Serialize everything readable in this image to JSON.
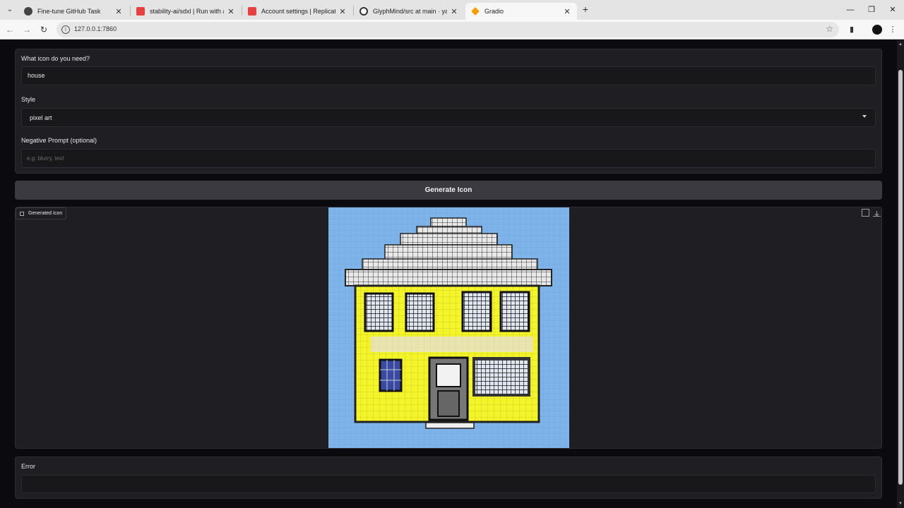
{
  "browser": {
    "tabs": [
      {
        "title": "Fine-tune GitHub Task",
        "icon": "openai-icon",
        "active": false
      },
      {
        "title": "stability-ai/sdxl | Run with an API",
        "icon": "replicate-icon",
        "active": false
      },
      {
        "title": "Account settings | Replicate",
        "icon": "replicate-icon",
        "active": false
      },
      {
        "title": "GlyphMind/src at main · yadukr",
        "icon": "github-icon",
        "active": false
      },
      {
        "title": "Gradio",
        "icon": "gradio-icon",
        "active": true
      }
    ],
    "url": "127.0.0.1:7860",
    "colors": {
      "replicate": "#e84040",
      "gradio": "#f59e0b"
    }
  },
  "form": {
    "prompt_label": "What icon do you need?",
    "prompt_value": "house",
    "style_label": "Style",
    "style_value": "pixel art",
    "negative_label": "Negative Prompt (optional)",
    "negative_placeholder": "e.g. blurry, text",
    "negative_value": ""
  },
  "generate_button": "Generate Icon",
  "output": {
    "label": "Generated Icon",
    "image_subject": "pixel-art-house-icon"
  },
  "error": {
    "label": "Error",
    "value": ""
  },
  "theme": {
    "background": "#0b0b0f",
    "panel": "#1f1f23",
    "button": "#3a3a40",
    "image_bg": "#7eb4ea",
    "house_wall": "#f4f42a"
  }
}
